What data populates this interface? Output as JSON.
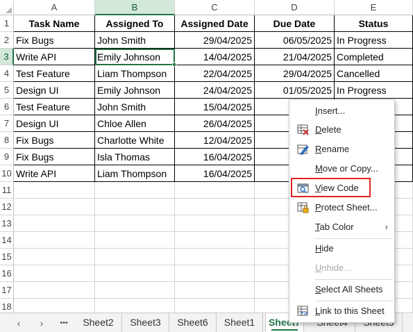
{
  "columns": [
    "A",
    "B",
    "C",
    "D",
    "E"
  ],
  "rows": [
    "1",
    "2",
    "3",
    "4",
    "5",
    "6",
    "7",
    "8",
    "9",
    "10",
    "11",
    "12",
    "13",
    "14",
    "15",
    "16",
    "17",
    "18"
  ],
  "table": {
    "headers": [
      "Task Name",
      "Assigned To",
      "Assigned Date",
      "Due Date",
      "Status"
    ],
    "records": [
      [
        "Fix Bugs",
        "John Smith",
        "29/04/2025",
        "06/05/2025",
        "In Progress"
      ],
      [
        "Write API",
        "Emily Johnson",
        "14/04/2025",
        "21/04/2025",
        "Completed"
      ],
      [
        "Test Feature",
        "Liam Thompson",
        "22/04/2025",
        "29/04/2025",
        "Cancelled"
      ],
      [
        "Design UI",
        "Emily Johnson",
        "24/04/2025",
        "01/05/2025",
        "In Progress"
      ],
      [
        "Test Feature",
        "John Smith",
        "15/04/2025",
        "2",
        ""
      ],
      [
        "Design UI",
        "Chloe Allen",
        "26/04/2025",
        "0",
        ""
      ],
      [
        "Fix Bugs",
        "Charlotte White",
        "12/04/2025",
        "1",
        ""
      ],
      [
        "Fix Bugs",
        "Isla Thomas",
        "16/04/2025",
        "2",
        ""
      ],
      [
        "Write API",
        "Liam Thompson",
        "16/04/2025",
        "2",
        ""
      ]
    ]
  },
  "context_menu": {
    "items": [
      {
        "label": "Insert...",
        "icon": "none"
      },
      {
        "label": "Delete",
        "icon": "delete-sheet-icon"
      },
      {
        "label": "Rename",
        "icon": "rename-icon"
      },
      {
        "label": "Move or Copy...",
        "icon": "none"
      },
      {
        "label": "View Code",
        "icon": "view-code-icon"
      },
      {
        "label": "Protect Sheet...",
        "icon": "protect-sheet-icon"
      },
      {
        "label": "Tab Color",
        "icon": "none"
      },
      {
        "label": "Hide",
        "icon": "none"
      },
      {
        "label": "Unhide...",
        "icon": "none"
      },
      {
        "label": "Select All Sheets",
        "icon": "none"
      },
      {
        "label": "Link to this Sheet",
        "icon": "link-sheet-icon"
      }
    ]
  },
  "tabs": {
    "ellipsis": "•••",
    "prev_arrow": "‹",
    "next_arrow": "›",
    "sheets": [
      "Sheet2",
      "Sheet3",
      "Sheet6",
      "Sheet1",
      "Sheet7",
      "Sheet4",
      "Sheet5"
    ],
    "active": "Sheet7"
  },
  "colors": {
    "accent": "#217346",
    "highlight": "#e0231f",
    "selected_header_bg": "#d2e8d9"
  }
}
